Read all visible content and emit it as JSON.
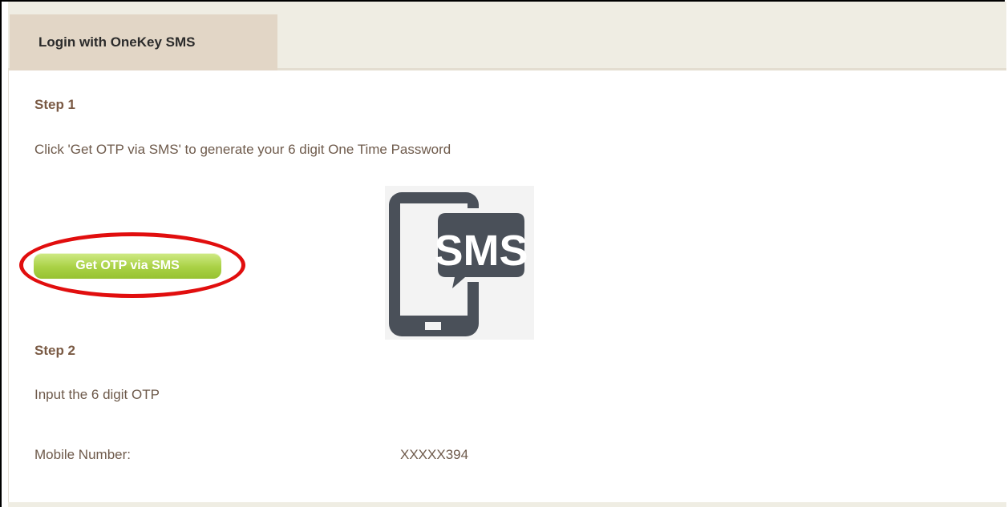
{
  "tab": {
    "label": "Login with OneKey SMS"
  },
  "step1": {
    "heading": "Step 1",
    "instruction": "Click 'Get OTP via SMS' to generate your 6 digit One Time Password",
    "button_label": "Get OTP via SMS"
  },
  "illustration": {
    "icon": "sms-phone-icon",
    "text": "SMS"
  },
  "step2": {
    "heading": "Step 2",
    "instruction": "Input the 6 digit OTP",
    "mobile_label": "Mobile Number:",
    "mobile_value": "XXXXX394"
  },
  "colors": {
    "button_green": "#a9d145",
    "highlight_red": "#e10e0e",
    "tab_background": "#e2d6c6",
    "heading_brown": "#7a5a44",
    "icon_gray": "#4a5059"
  }
}
